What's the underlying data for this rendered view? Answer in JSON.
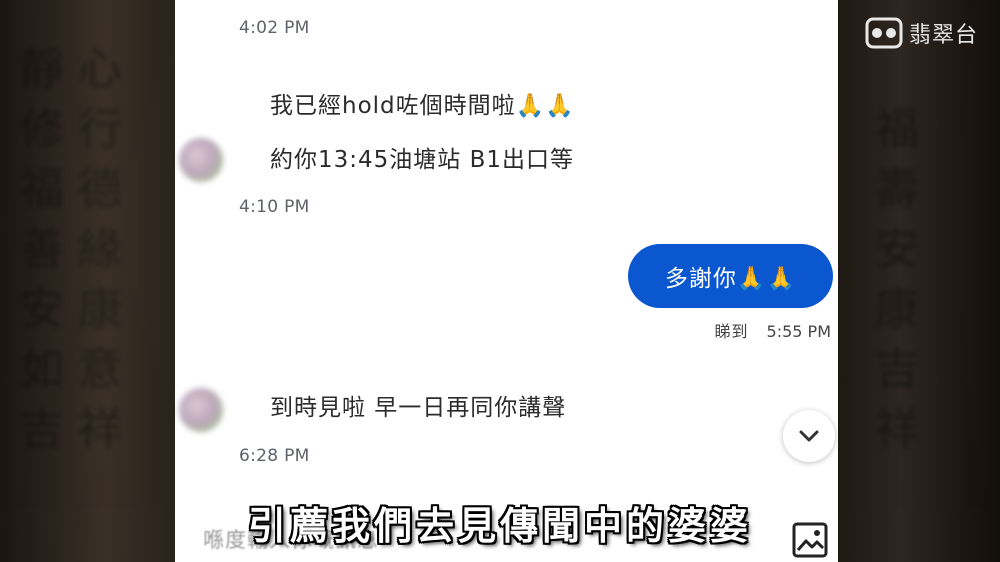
{
  "broadcast": {
    "logo_text": "翡翠台",
    "logo_icon": "tvb-icon",
    "subtitle": "引薦我們去見傳聞中的婆婆"
  },
  "chat": {
    "timestamps": {
      "first": "4:02 PM",
      "second": "4:10 PM",
      "third": "6:28 PM"
    },
    "incoming_group_1": {
      "line1": "我已經hold咗個時間啦🙏🙏",
      "line2": "約你13:45油塘站 B1出口等"
    },
    "outgoing": {
      "text": "多謝你🙏🙏",
      "status": "睇到",
      "time": "5:55 PM"
    },
    "incoming_group_2": {
      "line1": "到時見啦 早一日再同你講聲"
    },
    "scroll_icon": "chevron-down-icon",
    "input": {
      "placeholder": "喺度輸入你嘅訊息"
    },
    "image_button_icon": "image-icon"
  },
  "colors": {
    "outgoing_bubble": "#0b57d0",
    "background_page": "#ffffff"
  }
}
